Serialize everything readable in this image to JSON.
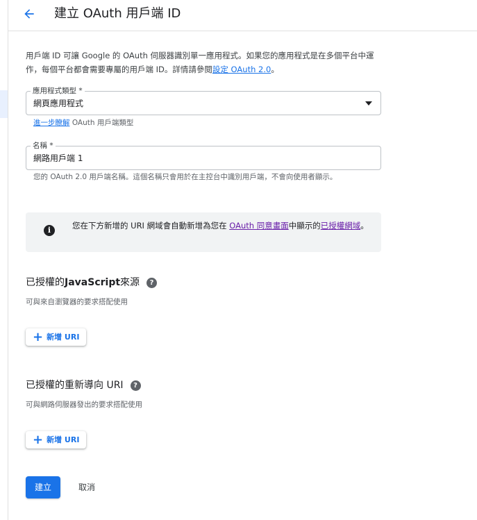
{
  "header": {
    "title": "建立 OAuth 用戶端 ID"
  },
  "intro": {
    "text": "用戶端 ID 可讓 Google 的 OAuth 伺服器識別單一應用程式。如果您的應用程式是在多個平台中運作，每個平台都會需要專屬的用戶端 ID。詳情請參閱",
    "link": "設定 OAuth 2.0",
    "suffix": "。"
  },
  "app_type": {
    "label": "應用程式類型 *",
    "value": "網頁應用程式",
    "learn_link": "進一步瞭解",
    "learn_suffix": " OAuth 用戶端類型"
  },
  "name_field": {
    "label": "名稱 *",
    "value": "網路用戶端 1",
    "helper": "您的 OAuth 2.0 用戶端名稱。這個名稱只會用於在主控台中識別用戶端，不會向使用者顯示。"
  },
  "info": {
    "icon_glyph": "i",
    "text_before": "您在下方新增的 URI 網域會自動新增為您在 ",
    "consent_link": "OAuth 同意畫面",
    "text_middle": "中顯示的",
    "domains_link": "已授權網域",
    "text_after": "。"
  },
  "js_origins": {
    "title_prefix": "已授權的 ",
    "title_bold": "JavaScript",
    "title_suffix": " 來源",
    "help_glyph": "?",
    "description": "可與來自瀏覽器的要求搭配使用",
    "add_glyph": "+",
    "add_label": "新增 URI"
  },
  "redirect_uris": {
    "title": "已授權的重新導向 URI",
    "help_glyph": "?",
    "description": "可與網路伺服器發出的要求搭配使用",
    "add_glyph": "+",
    "add_label": "新增 URI"
  },
  "actions": {
    "create": "建立",
    "cancel": "取消"
  },
  "colors": {
    "accent": "#1a73e8",
    "visited_link": "#681da8",
    "info_bg": "#f1f3f4"
  }
}
